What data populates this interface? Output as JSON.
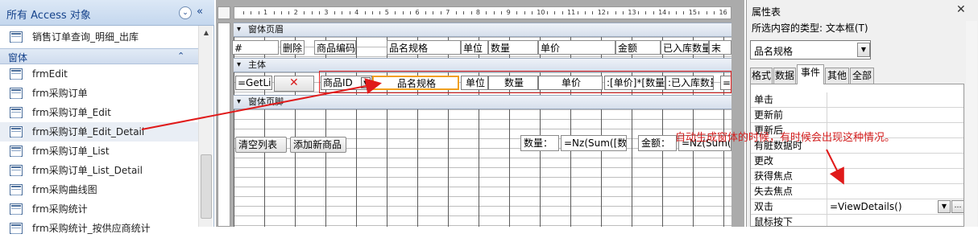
{
  "nav": {
    "title": "所有 Access 对象",
    "dropdown_glyph": "⌄",
    "collapse_glyph": "«",
    "query_item": "销售订单查询_明细_出库",
    "group_label": "窗体",
    "group_chevron": "⌃",
    "forms": [
      "frmEdit",
      "frm采购订单",
      "frm采购订单_Edit",
      "frm采购订单_Edit_Detail",
      "frm采购订单_List",
      "frm采购订单_List_Detail",
      "frm采购曲线图",
      "frm采购统计",
      "frm采购统计_按供应商统计"
    ],
    "selected_index": 3
  },
  "ruler": {
    "marks": [
      "1",
      "2",
      "3",
      "4",
      "5",
      "6",
      "7",
      "8",
      "9",
      "10",
      "11",
      "12",
      "13",
      "14",
      "15",
      "16"
    ]
  },
  "design": {
    "header_section": "窗体页眉",
    "detail_section": "主体",
    "footer_section": "窗体页脚",
    "header_labels": [
      "#",
      "删除",
      "商品编码",
      "品名规格",
      "单位",
      "数量",
      "单价",
      "金额",
      "已入库数量",
      "末"
    ],
    "detail_fields": [
      "=GetLir",
      "商品ID",
      "品名规格",
      "单位",
      "数量",
      "单价",
      ":[单价]*[数量",
      ":已入库数量",
      "="
    ],
    "footer_buttons": [
      "清空列表",
      "添加新商品"
    ],
    "footer_labels": [
      "数量：",
      "=Nz(Sum([数",
      "金额：",
      "=Nz(Sum(["
    ]
  },
  "props": {
    "title": "属性表",
    "close": "✕",
    "selection_type": "所选内容的类型: 文本框(T)",
    "selected_control": "品名规格",
    "tabs": [
      "格式",
      "数据",
      "事件",
      "其他",
      "全部"
    ],
    "active_tab_index": 2,
    "rows": [
      {
        "name": "单击",
        "value": ""
      },
      {
        "name": "更新前",
        "value": ""
      },
      {
        "name": "更新后",
        "value": ""
      },
      {
        "name": "有脏数据时",
        "value": ""
      },
      {
        "name": "更改",
        "value": ""
      },
      {
        "name": "获得焦点",
        "value": ""
      },
      {
        "name": "失去焦点",
        "value": ""
      },
      {
        "name": "双击",
        "value": "=ViewDetails()"
      },
      {
        "name": "鼠标按下",
        "value": ""
      }
    ],
    "row_button_builder": "…",
    "dropdown_glyph": "▼"
  },
  "annotation": {
    "text": "自动生成窗体的时候，有时候会出现这种情况。",
    "color": "#d21c1c"
  }
}
